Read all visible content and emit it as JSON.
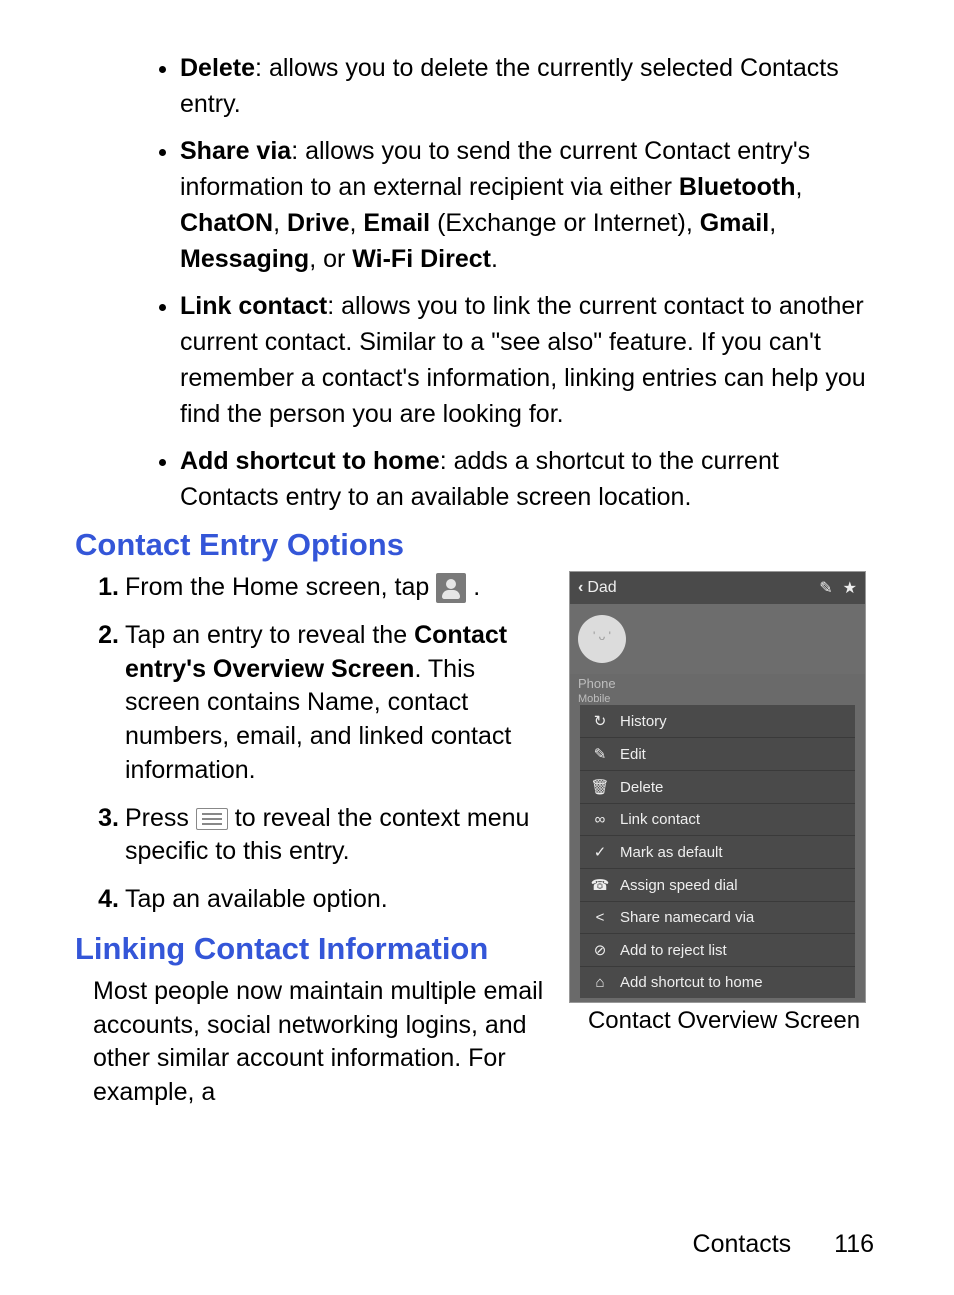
{
  "bullets": [
    {
      "term": "Delete",
      "desc": ": allows you to delete the currently selected Contacts entry."
    },
    {
      "term": "Share via",
      "desc_pre": ": allows you to send the current Contact entry's information to an external recipient via either ",
      "bolds": [
        "Bluetooth",
        "ChatON",
        "Drive",
        "Email"
      ],
      "mid": " (Exchange or Internet), ",
      "bolds2": [
        "Gmail",
        "Messaging"
      ],
      "tail_pre": ", or ",
      "tail_bold": "Wi-Fi Direct",
      "tail": "."
    },
    {
      "term": "Link contact",
      "desc": ": allows you to link the current contact to another current contact. Similar to a \"see also\" feature. If you can't remember a contact's information, linking entries can help you find the person you are looking for."
    },
    {
      "term": "Add shortcut to home",
      "desc": ": adds a shortcut to the current Contacts entry to an available screen location."
    }
  ],
  "h2a": "Contact Entry Options",
  "steps": [
    {
      "pre": "From the Home screen, tap",
      "icon": "contacts",
      "post": "."
    },
    {
      "pre": "Tap an entry to reveal the ",
      "bold": "Contact entry's Overview Screen",
      "post": ". This screen contains Name, contact numbers, email, and linked contact information."
    },
    {
      "pre": "Press ",
      "icon": "menu",
      "post": " to reveal the context menu specific to this entry."
    },
    {
      "pre": "Tap an available option."
    }
  ],
  "h2b": "Linking Contact Information",
  "body": "Most people now maintain multiple email accounts, social networking logins, and other similar account information. For example, a",
  "phone": {
    "back": "‹",
    "title": "Dad",
    "editIcon": "✎",
    "starIcon": "★",
    "section": "Phone",
    "small": "Mobile",
    "menu": [
      {
        "icon": "↻",
        "label": "History"
      },
      {
        "icon": "✎",
        "label": "Edit"
      },
      {
        "icon": "🗑",
        "label": "Delete"
      },
      {
        "icon": "∞",
        "label": "Link contact"
      },
      {
        "icon": "✓",
        "label": "Mark as default"
      },
      {
        "icon": "☎",
        "label": "Assign speed dial"
      },
      {
        "icon": "<",
        "label": "Share namecard via"
      },
      {
        "icon": "⊘",
        "label": "Add to reject list"
      },
      {
        "icon": "⌂",
        "label": "Add shortcut to home"
      }
    ]
  },
  "caption": "Contact Overview Screen",
  "footer": {
    "section": "Contacts",
    "page": "116"
  }
}
